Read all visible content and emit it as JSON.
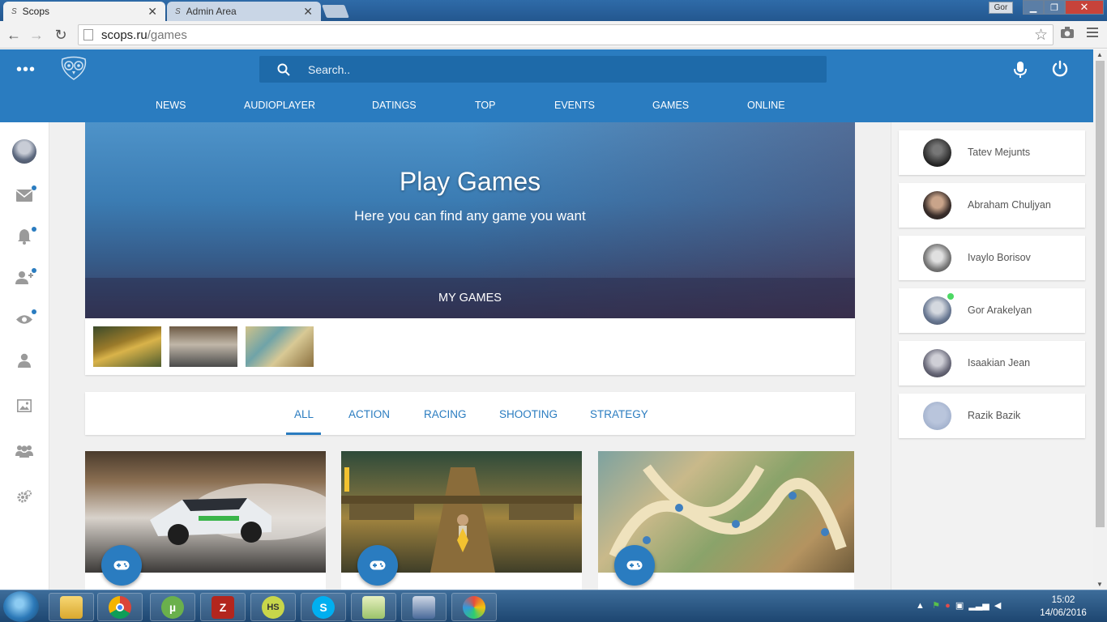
{
  "browser": {
    "tabs": [
      {
        "label": "Scops",
        "active": true
      },
      {
        "label": "Admin Area",
        "active": false
      }
    ],
    "profile_badge": "Gor",
    "url_host": "scops.ru",
    "url_path": "/games"
  },
  "header": {
    "search_placeholder": "Search..",
    "nav": [
      "NEWS",
      "AUDIOPLAYER",
      "DATINGS",
      "TOP",
      "EVENTS",
      "GAMES",
      "ONLINE"
    ]
  },
  "sidebar_left": {
    "icons": [
      "avatar",
      "mail-icon",
      "bell-icon",
      "add-friend-icon",
      "eye-icon",
      "user-icon",
      "image-icon",
      "group-icon",
      "settings-icon"
    ]
  },
  "hero": {
    "title": "Play Games",
    "subtitle": "Here you can find any game you want",
    "bar_label": "MY GAMES"
  },
  "my_games": [
    "temple-run-thumbnail",
    "drift-car-thumbnail",
    "board-map-thumbnail"
  ],
  "filters": {
    "tabs": [
      "ALL",
      "ACTION",
      "RACING",
      "SHOOTING",
      "STRATEGY"
    ],
    "active": "ALL"
  },
  "game_cards": [
    "drift-car-art",
    "temple-run-art",
    "board-map-art"
  ],
  "friends": [
    {
      "name": "Tatev Mejunts",
      "online": false
    },
    {
      "name": "Abraham Chuljyan",
      "online": false
    },
    {
      "name": "Ivaylo Borisov",
      "online": false
    },
    {
      "name": "Gor Arakelyan",
      "online": true
    },
    {
      "name": "Isaakian Jean",
      "online": false
    },
    {
      "name": "Razik Bazik",
      "online": false
    }
  ],
  "taskbar": {
    "apps": [
      "explorer",
      "chrome",
      "utorrent",
      "filezilla",
      "hotspot-shield",
      "skype",
      "notepad-plus",
      "screen-tool",
      "paint"
    ],
    "time": "15:02",
    "date": "14/06/2016"
  },
  "colors": {
    "brand": "#2a7cc0",
    "brand_dark": "#1e6aa9",
    "online": "#4cd964"
  }
}
